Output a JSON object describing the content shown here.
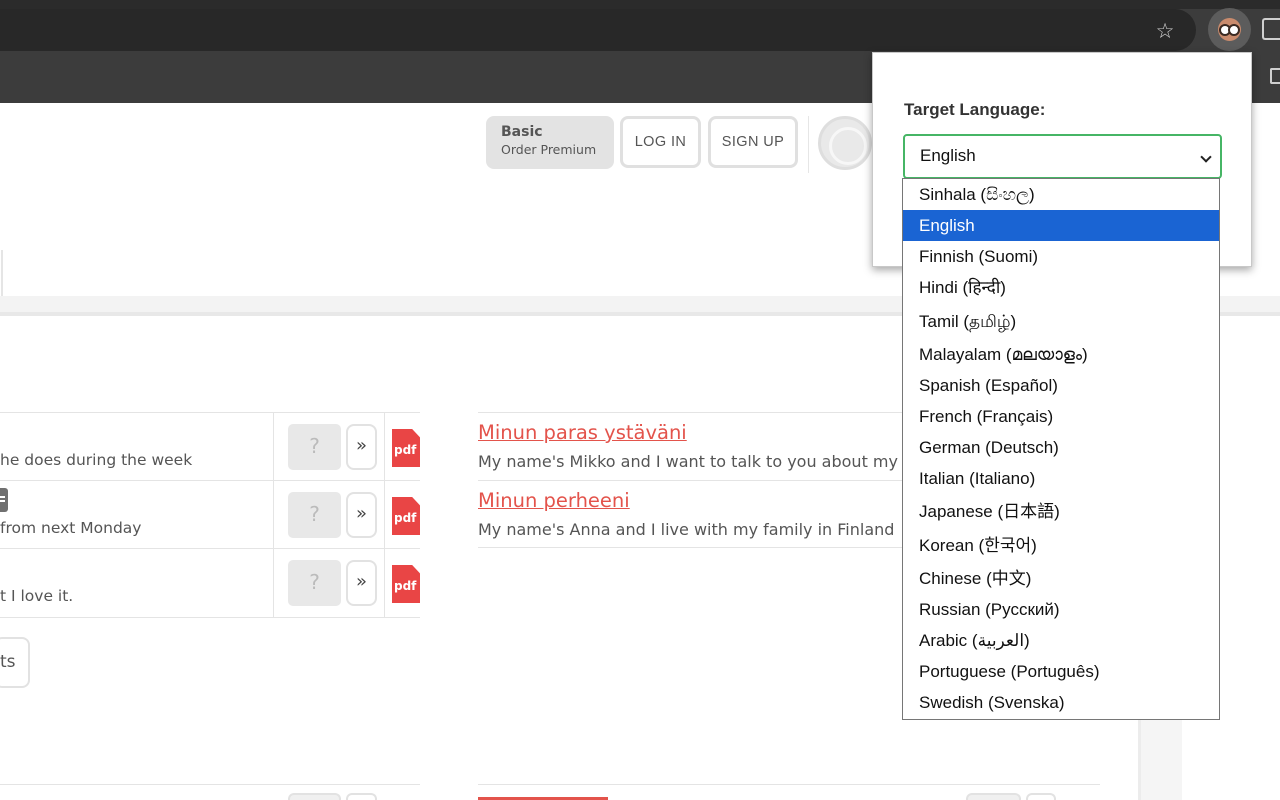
{
  "header": {
    "plan_name": "Basic",
    "plan_upgrade": "Order Premium",
    "login": "LOG IN",
    "signup": "SIGN UP"
  },
  "exercises": [
    {
      "text": "he does during the week",
      "help": "?",
      "next": "»",
      "pdf": "pdf"
    },
    {
      "text": "from next Monday",
      "help": "?",
      "next": "»",
      "pdf": "pdf"
    },
    {
      "text": "t I love it.",
      "help": "?",
      "next": "»",
      "pdf": "pdf"
    }
  ],
  "results_label": "ts",
  "stories": [
    {
      "title": "Minun paras ystäväni",
      "desc": "My name's Mikko and I want to talk to you about my bes"
    },
    {
      "title": "Minun perheeni",
      "desc": "My name's Anna and I live with my family in Finland"
    }
  ],
  "popup": {
    "label": "Target Language:",
    "selected": "English",
    "options": [
      "Sinhala (සිංහල)",
      "English",
      "Finnish (Suomi)",
      "Hindi (हिन्दी)",
      "Tamil (தமிழ்)",
      "Malayalam (മലയാളം)",
      "Spanish (Español)",
      "French (Français)",
      "German (Deutsch)",
      "Italian (Italiano)",
      "Japanese (日本語)",
      "Korean (한국어)",
      "Chinese (中文)",
      "Russian (Русский)",
      "Arabic (العربية)",
      "Portuguese (Português)",
      "Swedish (Svenska)"
    ],
    "selected_index": 1
  },
  "colors": {
    "accent_link": "#e3534b",
    "select_border": "#46b565",
    "option_highlight": "#1a64d3",
    "pdf_red": "#e94545"
  },
  "icons": {
    "star": "bookmark-star-icon",
    "extension": "owl-extension-icon",
    "puzzle": "extensions-puzzle-icon",
    "globe": "language-globe-icon",
    "pdf": "pdf-file-icon"
  }
}
